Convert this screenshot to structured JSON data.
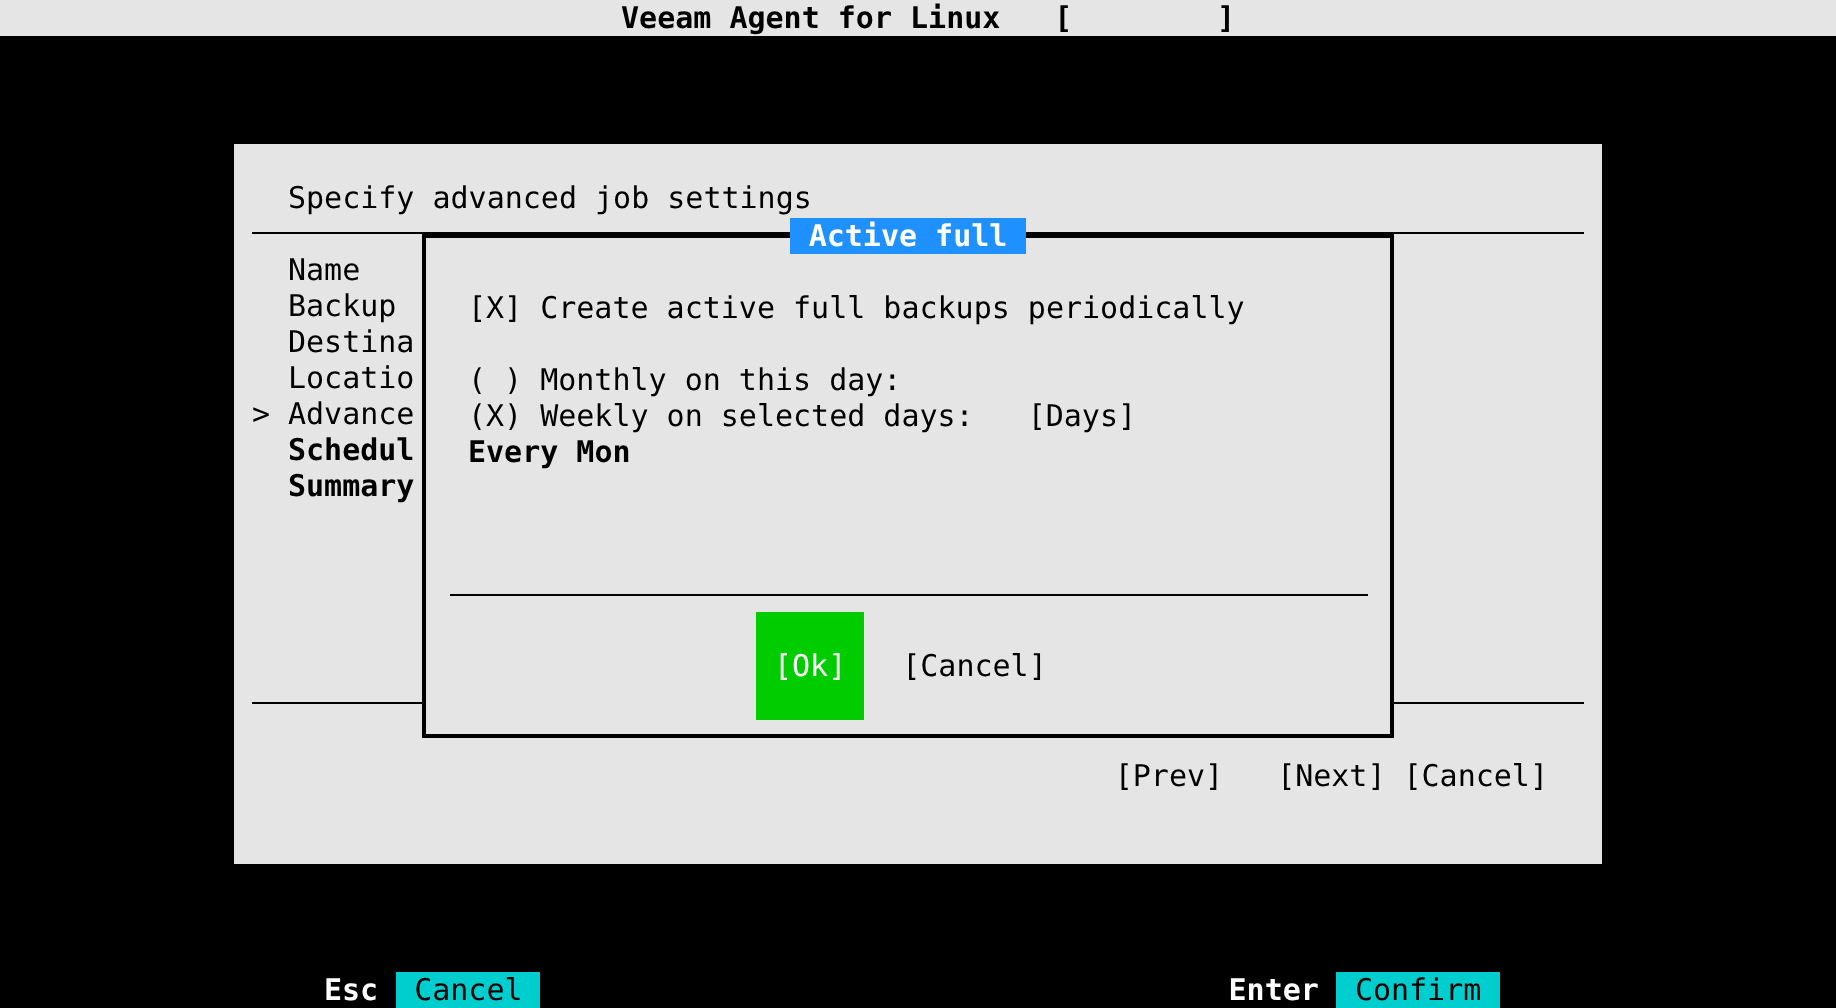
{
  "top_bar": {
    "title": "Veeam Agent for Linux",
    "indicator": "[        ]"
  },
  "wizard": {
    "heading": "Specify advanced job settings",
    "cursor": ">",
    "steps": [
      {
        "label": "Name",
        "selected": false,
        "pending": false
      },
      {
        "label": "Backup",
        "selected": false,
        "pending": false
      },
      {
        "label": "Destina",
        "selected": false,
        "pending": false
      },
      {
        "label": "Locatio",
        "selected": false,
        "pending": false
      },
      {
        "label": "Advance",
        "selected": true,
        "pending": false
      },
      {
        "label": "Schedul",
        "selected": false,
        "pending": true
      },
      {
        "label": "Summary",
        "selected": false,
        "pending": true
      }
    ],
    "buttons": [
      "[Prev]",
      "[Next]",
      "[Cancel]"
    ]
  },
  "dialog": {
    "title": "Active full",
    "options": [
      {
        "brackets": [
          "[",
          "]"
        ],
        "checked": true,
        "mark": "X",
        "label": "Create active full backups periodically"
      },
      {
        "brackets": [
          "(",
          ")"
        ],
        "checked": false,
        "label": "Monthly on this day:"
      },
      {
        "brackets": [
          "(",
          ")"
        ],
        "checked": true,
        "mark": "X",
        "label": "Weekly on selected days:",
        "button": "[Days]"
      }
    ],
    "summary": "Every Mon",
    "buttons": [
      {
        "label": "[Ok]",
        "selected": true
      },
      {
        "label": "[Cancel]",
        "selected": false
      }
    ]
  },
  "key_hints": [
    {
      "key": "Esc",
      "action": "Cancel"
    },
    {
      "key": "Enter",
      "action": "Confirm"
    }
  ]
}
